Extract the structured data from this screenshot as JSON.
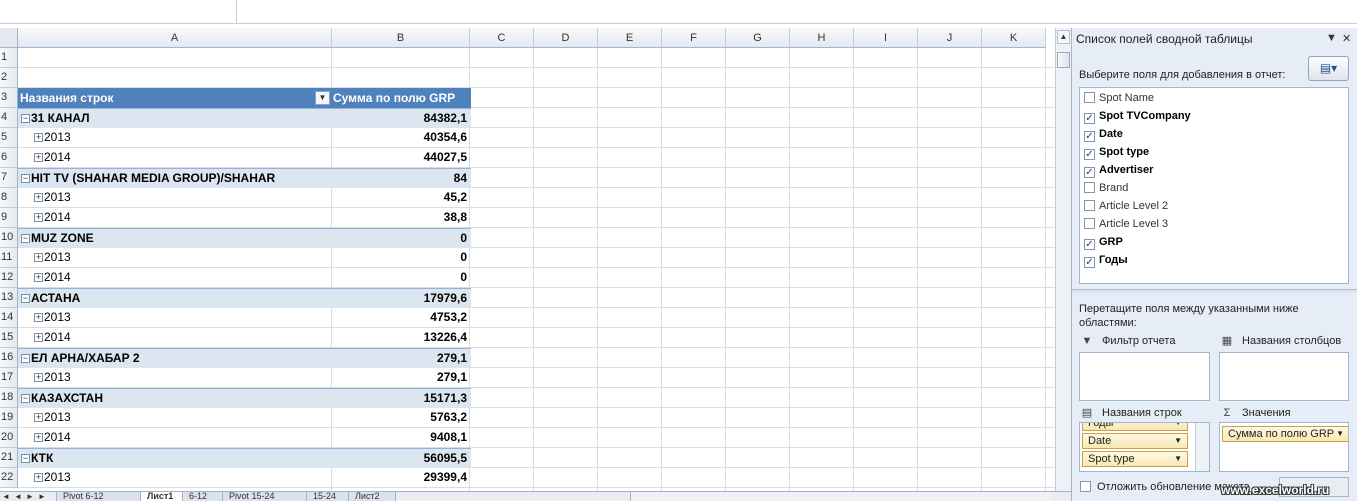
{
  "columns": [
    "A",
    "B",
    "C",
    "D",
    "E",
    "F",
    "G",
    "H",
    "I",
    "J",
    "K"
  ],
  "row_numbers": [
    "1",
    "2",
    "3",
    "4",
    "5",
    "6",
    "7",
    "8",
    "9",
    "10",
    "11",
    "12",
    "13",
    "14",
    "15",
    "16",
    "17",
    "18",
    "19",
    "20",
    "21",
    "22"
  ],
  "pivot": {
    "header_rows": "Названия строк",
    "header_values": "Сумма по полю GRP",
    "dropdown_glyph": "▼",
    "rows": [
      {
        "label": "31 КАНАЛ",
        "value": "84382,1",
        "group": true
      },
      {
        "label": "2013",
        "value": "40354,6",
        "group": false
      },
      {
        "label": "2014",
        "value": "44027,5",
        "group": false
      },
      {
        "label": "HIT TV (SHAHAR MEDIA GROUP)/SHAHAR",
        "value": "84",
        "group": true
      },
      {
        "label": "2013",
        "value": "45,2",
        "group": false
      },
      {
        "label": "2014",
        "value": "38,8",
        "group": false
      },
      {
        "label": "MUZ ZONE",
        "value": "0",
        "group": true
      },
      {
        "label": "2013",
        "value": "0",
        "group": false
      },
      {
        "label": "2014",
        "value": "0",
        "group": false
      },
      {
        "label": "АСТАНА",
        "value": "17979,6",
        "group": true
      },
      {
        "label": "2013",
        "value": "4753,2",
        "group": false
      },
      {
        "label": "2014",
        "value": "13226,4",
        "group": false
      },
      {
        "label": "ЕЛ АРНА/ХАБАР 2",
        "value": "279,1",
        "group": true
      },
      {
        "label": "2013",
        "value": "279,1",
        "group": false
      },
      {
        "label": "КАЗАХСТАН",
        "value": "15171,3",
        "group": true
      },
      {
        "label": "2013",
        "value": "5763,2",
        "group": false
      },
      {
        "label": "2014",
        "value": "9408,1",
        "group": false
      },
      {
        "label": "КТК",
        "value": "56095,5",
        "group": true
      },
      {
        "label": "2013",
        "value": "29399,4",
        "group": false
      }
    ]
  },
  "sheet_tabs": [
    "Pivot 6-12",
    "Лист1",
    "6-12",
    "Pivot 15-24",
    "15-24",
    "Лист2"
  ],
  "active_tab_index": 1,
  "field_list": {
    "title": "Список полей сводной таблицы",
    "prompt": "Выберите поля для добавления в отчет:",
    "fields": [
      {
        "name": "Spot Name",
        "checked": false
      },
      {
        "name": "Spot TVCompany",
        "checked": true
      },
      {
        "name": "Date",
        "checked": true
      },
      {
        "name": "Spot type",
        "checked": true
      },
      {
        "name": "Advertiser",
        "checked": true
      },
      {
        "name": "Brand",
        "checked": false
      },
      {
        "name": "Article Level 2",
        "checked": false
      },
      {
        "name": "Article Level 3",
        "checked": false
      },
      {
        "name": "GRP",
        "checked": true
      },
      {
        "name": "Годы",
        "checked": true
      }
    ],
    "drag_hint": "Перетащите поля между указанными ниже областями:",
    "areas": {
      "filter": "Фильтр отчета",
      "columns": "Названия столбцов",
      "rows": "Названия строк",
      "values": "Значения"
    },
    "row_chips": [
      "Годы",
      "Date",
      "Spot type"
    ],
    "value_chips": [
      "Сумма по полю GRP"
    ],
    "defer_label": "Отложить обновление макета"
  },
  "watermark": "www.excelworld.ru"
}
